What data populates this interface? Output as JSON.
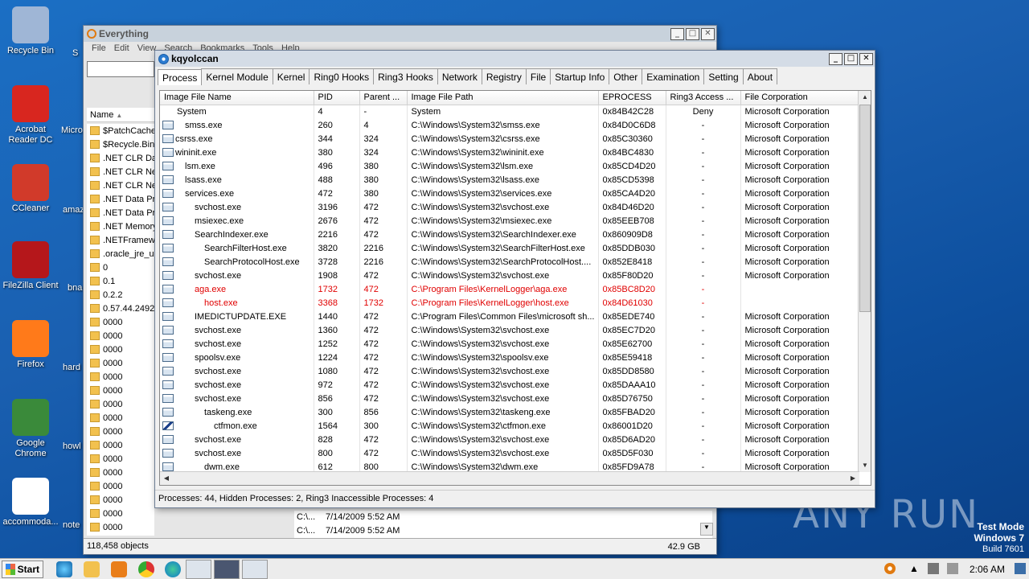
{
  "desktop": {
    "icons": [
      {
        "label": "Recycle Bin",
        "icon": "recycle-bin-icon",
        "color": "#9fb6d6"
      },
      {
        "label": "Acrobat Reader DC",
        "icon": "acrobat-icon",
        "color": "#d8261f"
      },
      {
        "label": "CCleaner",
        "icon": "ccleaner-icon",
        "color": "#d13a2a"
      },
      {
        "label": "FileZilla Client",
        "icon": "filezilla-icon",
        "color": "#b5171b"
      },
      {
        "label": "Firefox",
        "icon": "firefox-icon",
        "color": "#ff7a1a"
      },
      {
        "label": "Google Chrome",
        "icon": "chrome-icon",
        "color": "#3a8a3a"
      },
      {
        "label": "accommoda...",
        "icon": "file-icon",
        "color": "#ffffff"
      }
    ],
    "partial_labels": [
      "Micro",
      "amaz",
      "bna",
      "hard",
      "howl",
      "note",
      "S"
    ]
  },
  "watermark": "ANY RUN",
  "testmode": {
    "line1": "Test Mode",
    "line2": "Windows 7",
    "line3": "Build 7601"
  },
  "everything": {
    "title": "Everything",
    "menu": [
      "File",
      "Edit",
      "View",
      "Search",
      "Bookmarks",
      "Tools",
      "Help"
    ],
    "column_name": "Name",
    "files": [
      "$PatchCache",
      "$Recycle.Bin",
      ".NET CLR Dat",
      ".NET CLR Net",
      ".NET CLR Net",
      ".NET Data Pr",
      ".NET Data Pr",
      ".NET Memory",
      ".NETFramew",
      ".oracle_jre_u",
      "0",
      "0.1",
      "0.2.2",
      "0.57.44.2492",
      "0000",
      "0000",
      "0000",
      "0000",
      "0000",
      "0000",
      "0000",
      "0000",
      "0000",
      "0000",
      "0000",
      "0000",
      "0000",
      "0000",
      "0000",
      "0000"
    ],
    "extra_rows": [
      {
        "path": "C:\\...",
        "date": "7/14/2009 5:52 AM"
      },
      {
        "path": "C:\\...",
        "date": "7/14/2009 5:52 AM"
      }
    ],
    "status": "118,458 objects",
    "size": "42.9 GB"
  },
  "kq": {
    "title": "kqyolccan",
    "tabs": [
      "Process",
      "Kernel Module",
      "Kernel",
      "Ring0 Hooks",
      "Ring3 Hooks",
      "Network",
      "Registry",
      "File",
      "Startup Info",
      "Other",
      "Examination",
      "Setting",
      "About"
    ],
    "columns": [
      "Image File Name",
      "PID",
      "Parent ...",
      "Image File Path",
      "EPROCESS",
      "Ring3 Access ...",
      "File Corporation"
    ],
    "rows": [
      {
        "name": "System",
        "indent": 0,
        "pid": "4",
        "ppid": "-",
        "path": "System",
        "ep": "0x84B42C28",
        "r3": "Deny",
        "corp": "Microsoft Corporation",
        "hidden": false,
        "icon": "none"
      },
      {
        "name": "smss.exe",
        "indent": 1,
        "pid": "260",
        "ppid": "4",
        "path": "C:\\Windows\\System32\\smss.exe",
        "ep": "0x84D0C6D8",
        "r3": "-",
        "corp": "Microsoft Corporation",
        "hidden": false,
        "icon": "win"
      },
      {
        "name": "csrss.exe",
        "indent": 0,
        "pid": "344",
        "ppid": "324",
        "path": "C:\\Windows\\System32\\csrss.exe",
        "ep": "0x85C30360",
        "r3": "-",
        "corp": "Microsoft Corporation",
        "hidden": false,
        "icon": "win"
      },
      {
        "name": "wininit.exe",
        "indent": 0,
        "pid": "380",
        "ppid": "324",
        "path": "C:\\Windows\\System32\\wininit.exe",
        "ep": "0x84BC4830",
        "r3": "-",
        "corp": "Microsoft Corporation",
        "hidden": false,
        "icon": "win"
      },
      {
        "name": "lsm.exe",
        "indent": 1,
        "pid": "496",
        "ppid": "380",
        "path": "C:\\Windows\\System32\\lsm.exe",
        "ep": "0x85CD4D20",
        "r3": "-",
        "corp": "Microsoft Corporation",
        "hidden": false,
        "icon": "win"
      },
      {
        "name": "lsass.exe",
        "indent": 1,
        "pid": "488",
        "ppid": "380",
        "path": "C:\\Windows\\System32\\lsass.exe",
        "ep": "0x85CD5398",
        "r3": "-",
        "corp": "Microsoft Corporation",
        "hidden": false,
        "icon": "win"
      },
      {
        "name": "services.exe",
        "indent": 1,
        "pid": "472",
        "ppid": "380",
        "path": "C:\\Windows\\System32\\services.exe",
        "ep": "0x85CA4D20",
        "r3": "-",
        "corp": "Microsoft Corporation",
        "hidden": false,
        "icon": "win"
      },
      {
        "name": "svchost.exe",
        "indent": 2,
        "pid": "3196",
        "ppid": "472",
        "path": "C:\\Windows\\System32\\svchost.exe",
        "ep": "0x84D46D20",
        "r3": "-",
        "corp": "Microsoft Corporation",
        "hidden": false,
        "icon": "win"
      },
      {
        "name": "msiexec.exe",
        "indent": 2,
        "pid": "2676",
        "ppid": "472",
        "path": "C:\\Windows\\System32\\msiexec.exe",
        "ep": "0x85EEB708",
        "r3": "-",
        "corp": "Microsoft Corporation",
        "hidden": false,
        "icon": "win"
      },
      {
        "name": "SearchIndexer.exe",
        "indent": 2,
        "pid": "2216",
        "ppid": "472",
        "path": "C:\\Windows\\System32\\SearchIndexer.exe",
        "ep": "0x860909D8",
        "r3": "-",
        "corp": "Microsoft Corporation",
        "hidden": false,
        "icon": "win"
      },
      {
        "name": "SearchFilterHost.exe",
        "indent": 3,
        "pid": "3820",
        "ppid": "2216",
        "path": "C:\\Windows\\System32\\SearchFilterHost.exe",
        "ep": "0x85DDB030",
        "r3": "-",
        "corp": "Microsoft Corporation",
        "hidden": false,
        "icon": "win"
      },
      {
        "name": "SearchProtocolHost.exe",
        "indent": 3,
        "pid": "3728",
        "ppid": "2216",
        "path": "C:\\Windows\\System32\\SearchProtocolHost....",
        "ep": "0x852E8418",
        "r3": "-",
        "corp": "Microsoft Corporation",
        "hidden": false,
        "icon": "win"
      },
      {
        "name": "svchost.exe",
        "indent": 2,
        "pid": "1908",
        "ppid": "472",
        "path": "C:\\Windows\\System32\\svchost.exe",
        "ep": "0x85F80D20",
        "r3": "-",
        "corp": "Microsoft Corporation",
        "hidden": false,
        "icon": "win"
      },
      {
        "name": "aga.exe",
        "indent": 2,
        "pid": "1732",
        "ppid": "472",
        "path": "C:\\Program Files\\KernelLogger\\aga.exe",
        "ep": "0x85BC8D20",
        "r3": "-",
        "corp": "",
        "hidden": true,
        "icon": "win"
      },
      {
        "name": "host.exe",
        "indent": 3,
        "pid": "3368",
        "ppid": "1732",
        "path": "C:\\Program Files\\KernelLogger\\host.exe",
        "ep": "0x84D61030",
        "r3": "-",
        "corp": "",
        "hidden": true,
        "icon": "win"
      },
      {
        "name": "IMEDICTUPDATE.EXE",
        "indent": 2,
        "pid": "1440",
        "ppid": "472",
        "path": "C:\\Program Files\\Common Files\\microsoft sh...",
        "ep": "0x85EDE740",
        "r3": "-",
        "corp": "Microsoft Corporation",
        "hidden": false,
        "icon": "win"
      },
      {
        "name": "svchost.exe",
        "indent": 2,
        "pid": "1360",
        "ppid": "472",
        "path": "C:\\Windows\\System32\\svchost.exe",
        "ep": "0x85EC7D20",
        "r3": "-",
        "corp": "Microsoft Corporation",
        "hidden": false,
        "icon": "win"
      },
      {
        "name": "svchost.exe",
        "indent": 2,
        "pid": "1252",
        "ppid": "472",
        "path": "C:\\Windows\\System32\\svchost.exe",
        "ep": "0x85E62700",
        "r3": "-",
        "corp": "Microsoft Corporation",
        "hidden": false,
        "icon": "win"
      },
      {
        "name": "spoolsv.exe",
        "indent": 2,
        "pid": "1224",
        "ppid": "472",
        "path": "C:\\Windows\\System32\\spoolsv.exe",
        "ep": "0x85E59418",
        "r3": "-",
        "corp": "Microsoft Corporation",
        "hidden": false,
        "icon": "win"
      },
      {
        "name": "svchost.exe",
        "indent": 2,
        "pid": "1080",
        "ppid": "472",
        "path": "C:\\Windows\\System32\\svchost.exe",
        "ep": "0x85DD8580",
        "r3": "-",
        "corp": "Microsoft Corporation",
        "hidden": false,
        "icon": "win"
      },
      {
        "name": "svchost.exe",
        "indent": 2,
        "pid": "972",
        "ppid": "472",
        "path": "C:\\Windows\\System32\\svchost.exe",
        "ep": "0x85DAAA10",
        "r3": "-",
        "corp": "Microsoft Corporation",
        "hidden": false,
        "icon": "win"
      },
      {
        "name": "svchost.exe",
        "indent": 2,
        "pid": "856",
        "ppid": "472",
        "path": "C:\\Windows\\System32\\svchost.exe",
        "ep": "0x85D76750",
        "r3": "-",
        "corp": "Microsoft Corporation",
        "hidden": false,
        "icon": "win"
      },
      {
        "name": "taskeng.exe",
        "indent": 3,
        "pid": "300",
        "ppid": "856",
        "path": "C:\\Windows\\System32\\taskeng.exe",
        "ep": "0x85FBAD20",
        "r3": "-",
        "corp": "Microsoft Corporation",
        "hidden": false,
        "icon": "win"
      },
      {
        "name": "ctfmon.exe",
        "indent": 4,
        "pid": "1564",
        "ppid": "300",
        "path": "C:\\Windows\\System32\\ctfmon.exe",
        "ep": "0x86001D20",
        "r3": "-",
        "corp": "Microsoft Corporation",
        "hidden": false,
        "icon": "pen"
      },
      {
        "name": "svchost.exe",
        "indent": 2,
        "pid": "828",
        "ppid": "472",
        "path": "C:\\Windows\\System32\\svchost.exe",
        "ep": "0x85D6AD20",
        "r3": "-",
        "corp": "Microsoft Corporation",
        "hidden": false,
        "icon": "win"
      },
      {
        "name": "svchost.exe",
        "indent": 2,
        "pid": "800",
        "ppid": "472",
        "path": "C:\\Windows\\System32\\svchost.exe",
        "ep": "0x85D5F030",
        "r3": "-",
        "corp": "Microsoft Corporation",
        "hidden": false,
        "icon": "win"
      },
      {
        "name": "dwm.exe",
        "indent": 3,
        "pid": "612",
        "ppid": "800",
        "path": "C:\\Windows\\System32\\dwm.exe",
        "ep": "0x85FD9A78",
        "r3": "-",
        "corp": "Microsoft Corporation",
        "hidden": false,
        "icon": "win"
      }
    ],
    "status": "Processes: 44, Hidden Processes: 2, Ring3 Inaccessible Processes: 4"
  },
  "taskbar": {
    "start_label": "Start",
    "clock": "2:06 AM"
  }
}
